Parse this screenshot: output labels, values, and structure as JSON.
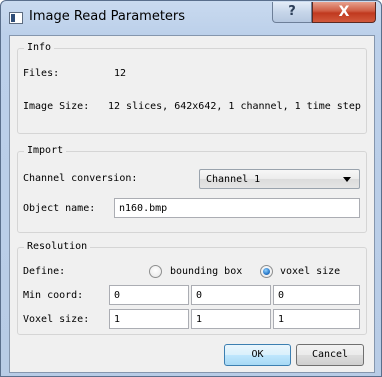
{
  "window": {
    "title": "Image Read Parameters",
    "help_label": "?",
    "close_label": "X"
  },
  "info": {
    "legend": "Info",
    "files_label": "Files:",
    "files_value": "12",
    "image_size_label": "Image Size:",
    "image_size_value": "12 slices, 642x642, 1 channel, 1 time step"
  },
  "import": {
    "legend": "Import",
    "channel_conversion_label": "Channel conversion:",
    "channel_conversion_value": "Channel 1",
    "object_name_label": "Object name:",
    "object_name_value": "n160.bmp"
  },
  "resolution": {
    "legend": "Resolution",
    "define_label": "Define:",
    "option_bounding_box": "bounding box",
    "option_voxel_size": "voxel size",
    "selected": "voxel size",
    "min_coord_label": "Min coord:",
    "min_coord": [
      "0",
      "0",
      "0"
    ],
    "voxel_size_label": "Voxel size:",
    "voxel_size": [
      "1",
      "1",
      "1"
    ]
  },
  "buttons": {
    "ok": "OK",
    "cancel": "Cancel"
  },
  "colors": {
    "title_bar": "#bcd0ea",
    "close_button": "#c0391f",
    "radio_selected": "#2a78c8"
  }
}
